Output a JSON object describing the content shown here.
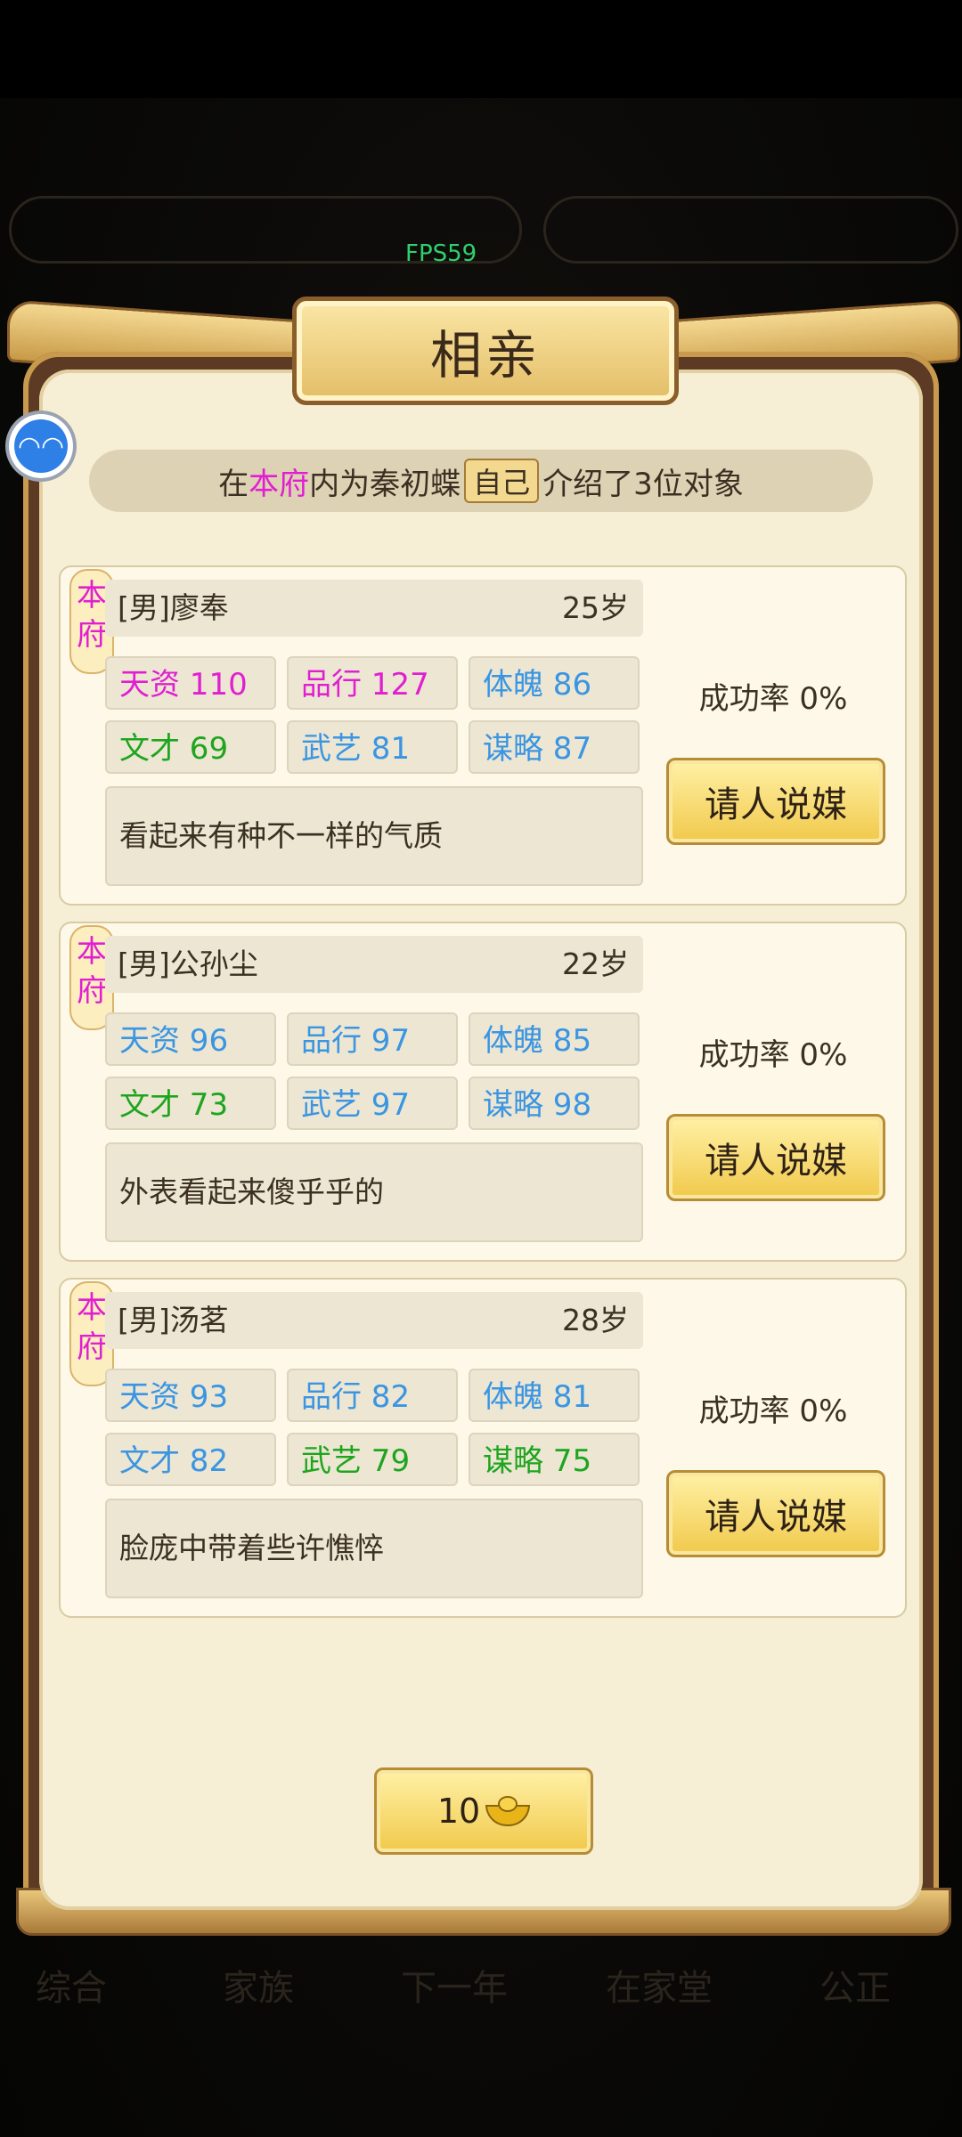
{
  "fps": "FPS59",
  "title": "相亲",
  "intro": {
    "prefix": "在",
    "house": "本府",
    "middle": "内为秦初蝶",
    "self": "自己",
    "suffix": "介绍了3位对象"
  },
  "colors": {
    "pink": "#e020d0",
    "blue": "#3a95e2",
    "green": "#1ea51e"
  },
  "candidates": [
    {
      "house_tag": "本府",
      "name": "[男]廖奉",
      "age": "25岁",
      "stats": [
        {
          "label": "天资 110",
          "color": "pink"
        },
        {
          "label": "品行 127",
          "color": "pink"
        },
        {
          "label": "体魄 86",
          "color": "blue"
        },
        {
          "label": "文才 69",
          "color": "green"
        },
        {
          "label": "武艺 81",
          "color": "blue"
        },
        {
          "label": "谋略 87",
          "color": "blue"
        }
      ],
      "desc": "看起来有种不一样的气质",
      "rate": "成功率 0%",
      "button": "请人说媒"
    },
    {
      "house_tag": "本府",
      "name": "[男]公孙尘",
      "age": "22岁",
      "stats": [
        {
          "label": "天资 96",
          "color": "blue"
        },
        {
          "label": "品行 97",
          "color": "blue"
        },
        {
          "label": "体魄 85",
          "color": "blue"
        },
        {
          "label": "文才 73",
          "color": "green"
        },
        {
          "label": "武艺 97",
          "color": "blue"
        },
        {
          "label": "谋略 98",
          "color": "blue"
        }
      ],
      "desc": "外表看起来傻乎乎的",
      "rate": "成功率 0%",
      "button": "请人说媒"
    },
    {
      "house_tag": "本府",
      "name": "[男]汤茗",
      "age": "28岁",
      "stats": [
        {
          "label": "天资 93",
          "color": "blue"
        },
        {
          "label": "品行 82",
          "color": "blue"
        },
        {
          "label": "体魄 81",
          "color": "blue"
        },
        {
          "label": "文才 82",
          "color": "blue"
        },
        {
          "label": "武艺 79",
          "color": "green"
        },
        {
          "label": "谋略 75",
          "color": "green"
        }
      ],
      "desc": "脸庞中带着些许憔悴",
      "rate": "成功率 0%",
      "button": "请人说媒"
    }
  ],
  "cost": {
    "amount": "10",
    "icon": "gold-ingot-icon"
  },
  "background_nav": [
    "综合",
    "家族",
    "下一年",
    "在家堂",
    "公正"
  ]
}
